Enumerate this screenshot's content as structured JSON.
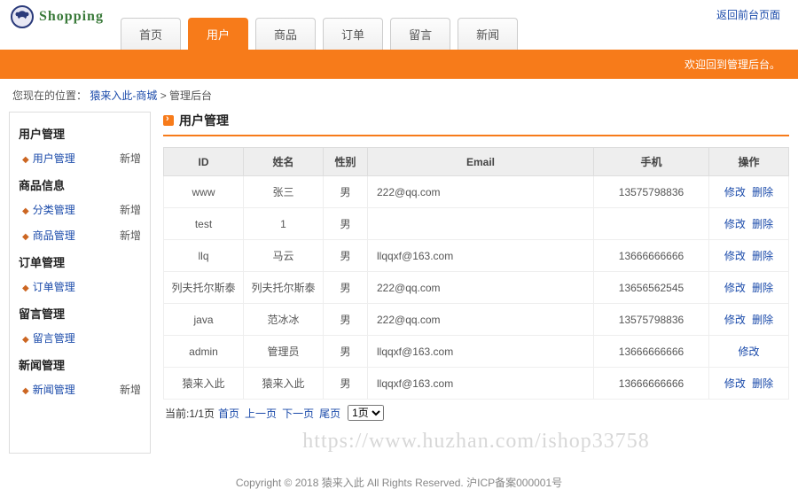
{
  "header": {
    "logo_text": "Shopping",
    "back_link": "返回前台页面",
    "tabs": [
      {
        "label": "首页",
        "active": false
      },
      {
        "label": "用户",
        "active": true
      },
      {
        "label": "商品",
        "active": false
      },
      {
        "label": "订单",
        "active": false
      },
      {
        "label": "留言",
        "active": false
      },
      {
        "label": "新闻",
        "active": false
      }
    ],
    "welcome": "欢迎回到管理后台。"
  },
  "breadcrumb": {
    "prefix": "您现在的位置：",
    "link": "猿来入此-商城",
    "sep": " > ",
    "current": "管理后台"
  },
  "sidebar": {
    "add_label": "新增",
    "groups": [
      {
        "title": "用户管理",
        "items": [
          {
            "label": "用户管理",
            "add": true
          }
        ]
      },
      {
        "title": "商品信息",
        "items": [
          {
            "label": "分类管理",
            "add": true
          },
          {
            "label": "商品管理",
            "add": true
          }
        ]
      },
      {
        "title": "订单管理",
        "items": [
          {
            "label": "订单管理",
            "add": false
          }
        ]
      },
      {
        "title": "留言管理",
        "items": [
          {
            "label": "留言管理",
            "add": false
          }
        ]
      },
      {
        "title": "新闻管理",
        "items": [
          {
            "label": "新闻管理",
            "add": true
          }
        ]
      }
    ]
  },
  "content": {
    "title": "用户管理",
    "columns": [
      "ID",
      "姓名",
      "性别",
      "Email",
      "手机",
      "操作"
    ],
    "action_edit": "修改",
    "action_delete": "删除",
    "rows": [
      {
        "id": "www",
        "name": "张三",
        "gender": "男",
        "email": "222@qq.com",
        "phone": "13575798836",
        "can_delete": true
      },
      {
        "id": "test",
        "name": "1",
        "gender": "男",
        "email": "",
        "phone": "",
        "can_delete": true
      },
      {
        "id": "llq",
        "name": "马云",
        "gender": "男",
        "email": "llqqxf@163.com",
        "phone": "13666666666",
        "can_delete": true
      },
      {
        "id": "列夫托尔斯泰",
        "name": "列夫托尔斯泰",
        "gender": "男",
        "email": "222@qq.com",
        "phone": "13656562545",
        "can_delete": true
      },
      {
        "id": "java",
        "name": "范冰冰",
        "gender": "男",
        "email": "222@qq.com",
        "phone": "13575798836",
        "can_delete": true
      },
      {
        "id": "admin",
        "name": "管理员",
        "gender": "男",
        "email": "llqqxf@163.com",
        "phone": "13666666666",
        "can_delete": false
      },
      {
        "id": "猿来入此",
        "name": "猿来入此",
        "gender": "男",
        "email": "llqqxf@163.com",
        "phone": "13666666666",
        "can_delete": true
      }
    ],
    "pager": {
      "status": "当前:1/1页",
      "first": "首页",
      "prev": "上一页",
      "next": "下一页",
      "last": "尾页",
      "select_value": "1页"
    }
  },
  "watermark": "https://www.huzhan.com/ishop33758",
  "footer": {
    "text": "Copyright © 2018 猿来入此 All Rights Reserved. ",
    "icp": "沪ICP备案000001号"
  }
}
